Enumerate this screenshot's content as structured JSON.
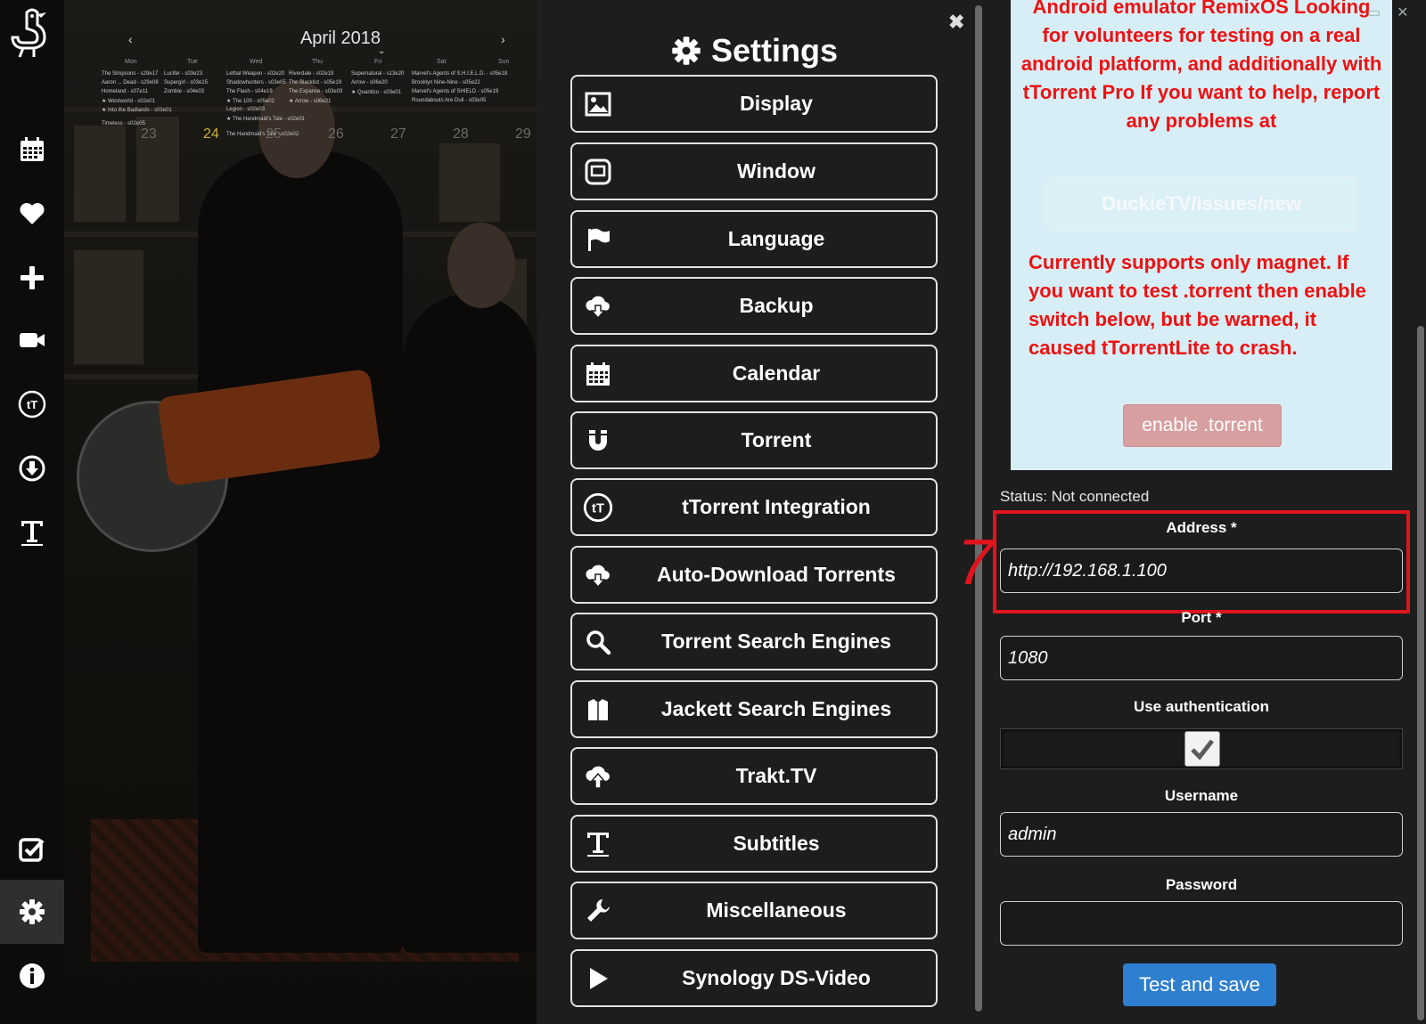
{
  "calendar": {
    "title": "April 2018",
    "prev": "‹",
    "next": "›",
    "weekdays": [
      "Mon",
      "Tue",
      "Wed",
      "Thu",
      "Fri",
      "Sat",
      "Sun"
    ],
    "days": [
      "23",
      "24",
      "25",
      "26",
      "27",
      "28",
      "29"
    ],
    "events": [
      "The Simpsons - s29e17",
      "Aaron ... Dead - s29e08",
      "Homeland - s07e11",
      "★ Westworld - s02e01",
      "★ Into the Badlands - s03e01",
      "Timeless - s02e05",
      "Lucifer - s03e23",
      "Supergirl - s03e15",
      "Zombie - s04e03",
      "Lethal Weapon - s02e20",
      "Shadowhunters - s03e05",
      "The Flash - s04e19",
      "★ The 100 - s05e02",
      "Legion - s02e03",
      "★ The Handmaid's Tale - s02e01",
      "The Handmaid's Tale - s02e02",
      "Riverdale - s02e19",
      "The Blacklist - s05e19",
      "The Expanse - s03e03",
      "★ Arrow - s06e21",
      "Supernatural - s13e20",
      "Arrow - s06e20",
      "★ Quantico - s03e01",
      "Marvel's Agents of S.H.I.E.L.D. - s05e18",
      "Brooklyn Nine-Nine - s05e22",
      "Marvel's Agents of SHIELD - s05e19",
      "Roundabouts Are Dull - s03e05"
    ]
  },
  "settings": {
    "title": "Settings",
    "close": "✖",
    "menu": [
      {
        "label": "Display",
        "icon": "image-icon"
      },
      {
        "label": "Window",
        "icon": "window-icon"
      },
      {
        "label": "Language",
        "icon": "flag-icon"
      },
      {
        "label": "Backup",
        "icon": "cloud-download-icon"
      },
      {
        "label": "Calendar",
        "icon": "calendar-icon"
      },
      {
        "label": "Torrent",
        "icon": "magnet-icon"
      },
      {
        "label": "tTorrent Integration",
        "icon": "ttorrent-icon"
      },
      {
        "label": "Auto-Download Torrents",
        "icon": "cloud-download-icon"
      },
      {
        "label": "Torrent Search Engines",
        "icon": "search-icon"
      },
      {
        "label": "Jackett Search Engines",
        "icon": "jacket-icon"
      },
      {
        "label": "Trakt.TV",
        "icon": "cloud-upload-icon"
      },
      {
        "label": "Subtitles",
        "icon": "text-icon"
      },
      {
        "label": "Miscellaneous",
        "icon": "wrench-icon"
      },
      {
        "label": "Synology DS-Video",
        "icon": "play-icon"
      }
    ]
  },
  "panel": {
    "notice_1": "Android emulator RemixOS Looking for volunteers for testing on a real android platform, and additionally with tTorrent Pro If you want to help, report any problems at",
    "issues_link": "DuckieTV/issues/new",
    "notice_2": "Currently supports only magnet. If you want to test .torrent then enable switch below, but be warned, it caused tTorrentLite to crash.",
    "enable_button": "enable .torrent",
    "status": "Status: Not connected",
    "address_label": "Address *",
    "address_value": "http://192.168.1.100",
    "port_label": "Port *",
    "port_value": "1080",
    "auth_label": "Use authentication",
    "auth_checked": true,
    "username_label": "Username",
    "username_value": "admin",
    "password_label": "Password",
    "password_value": "",
    "submit": "Test and save",
    "annotation": "7",
    "annotation_color": "#e0141c"
  },
  "sidebar": {
    "items": [
      "logo",
      "calendar-icon",
      "heart-icon",
      "plus-icon",
      "video-camera-icon",
      "ttorrent-icon",
      "download-circle-icon",
      "text-icon",
      "check-square-icon",
      "gear-icon",
      "info-icon"
    ],
    "active": "gear-icon"
  },
  "colors": {
    "accent": "#2f7fd0",
    "warning_text": "#ee1111",
    "info_bg": "#d8eef6"
  }
}
